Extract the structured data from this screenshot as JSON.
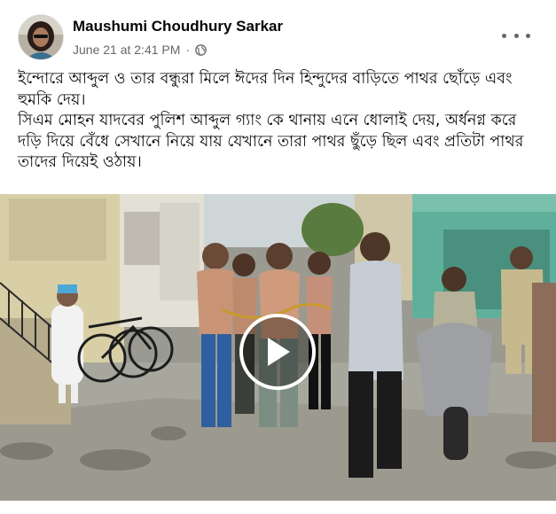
{
  "post": {
    "author_name": "Maushumi Choudhury Sarkar",
    "timestamp": "June 21 at 2:41 PM",
    "separator": "·",
    "privacy_icon": "globe-icon",
    "menu_icon": "more-options-icon",
    "text_paragraph_1": "ইন্দোরে আব্দুল ও তার বন্ধুরা মিলে ঈদের দিন হিন্দুদের বাড়িতে পাথর ছোঁড়ে এবং হুমকি দেয়।",
    "text_paragraph_2": "সিএম মোহন যাদবের পুলিশ আব্দুল গ্যাং কে থানায় এনে ধোলাই দেয়, অর্ধনগ্ন করে দড়ি দিয়ে বেঁধে সেখানে নিয়ে যায় যেখানে তারা পাথর ছুঁড়ে ছিল এবং প্রতিটা পাথর তাদের দিয়েই ওঠায়।"
  },
  "media": {
    "type": "video",
    "play_icon": "play-icon"
  },
  "colors": {
    "text_primary": "#050505",
    "text_secondary": "#65676b",
    "background": "#ffffff"
  }
}
